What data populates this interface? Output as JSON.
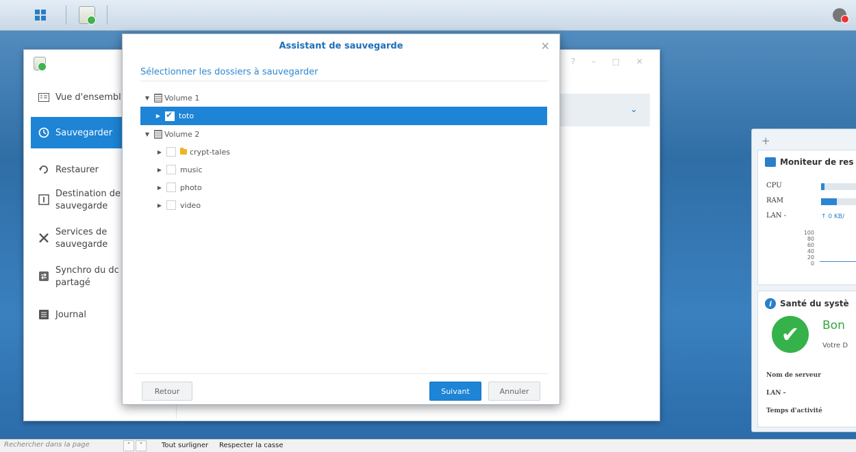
{
  "wizard": {
    "title": "Assistant de sauvegarde",
    "subtitle": "Sélectionner les dossiers à sauvegarder",
    "tree": {
      "volume1": "Volume 1",
      "volume1_items": [
        {
          "label": "toto",
          "checked": true
        }
      ],
      "volume2": "Volume 2",
      "volume2_items": [
        {
          "label": "crypt-tales",
          "checked": false
        },
        {
          "label": "music",
          "checked": false
        },
        {
          "label": "photo",
          "checked": false
        },
        {
          "label": "video",
          "checked": false
        }
      ]
    },
    "buttons": {
      "back": "Retour",
      "next": "Suivant",
      "cancel": "Annuler"
    }
  },
  "sidebar": {
    "items": [
      {
        "label": "Vue d'ensembl",
        "icon": "overview-icon"
      },
      {
        "label": "Sauvegarder",
        "icon": "backup-clock-icon"
      },
      {
        "label": "Restaurer",
        "icon": "restore-icon"
      },
      {
        "label1": "Destination de",
        "label2": "sauvegarde",
        "icon": "destination-icon"
      },
      {
        "label1": "Services de",
        "label2": "sauvegarde",
        "icon": "tools-icon"
      },
      {
        "label1": "Synchro du dc",
        "label2": "partagé",
        "icon": "sync-icon"
      },
      {
        "label": "Journal",
        "icon": "log-icon"
      }
    ]
  },
  "widgets": {
    "monitor_title": "Moniteur de res",
    "cpu": "CPU",
    "ram": "RAM",
    "lan": "LAN -",
    "lan_value": "↑ 0 KB/",
    "cpu_fraction": 0.08,
    "ram_fraction": 0.38,
    "axis": [
      "100",
      "80",
      "60",
      "40",
      "20",
      "0"
    ],
    "health_title": "Santé du systè",
    "health_status": "Bon",
    "health_desc": "Votre D",
    "server_name_label": "Nom de serveur",
    "lan_label": "LAN -",
    "uptime_label": "Temps d'activité"
  },
  "findbar": {
    "placeholder": "Rechercher dans la page",
    "highlight_all": "Tout surligner",
    "match_case": "Respecter la casse"
  },
  "colors": {
    "accent": "#1d84d6",
    "health_ok": "#35b249"
  }
}
